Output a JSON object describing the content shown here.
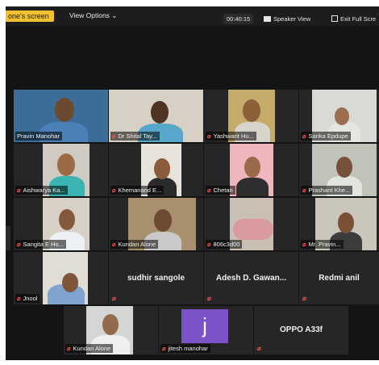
{
  "topbar": {
    "share_label": "one's screen",
    "view_options": "View Options ⌄",
    "clock": "00:40:15",
    "speaker_view": "Speaker View",
    "exit_fullscreen": "Exit Full Scre"
  },
  "participants": [
    {
      "name": "Pravin Manohar"
    },
    {
      "name": "Dr Shital Tay..."
    },
    {
      "name": "Yashwant Hu..."
    },
    {
      "name": "Sarika Epdupe"
    },
    {
      "name": "Aishwarya Ka..."
    },
    {
      "name": "Khemanand E..."
    },
    {
      "name": "Chetan"
    },
    {
      "name": "Prashant Khe..."
    },
    {
      "name": "Sangita E Ho..."
    },
    {
      "name": "Kundan Alone"
    },
    {
      "name": "806c3d00"
    },
    {
      "name": "Mr. Pravin..."
    },
    {
      "name": "Jnool"
    },
    {
      "name": "sudhir sangole"
    },
    {
      "name": "Adesh D. Gawan..."
    },
    {
      "name": "Redmi anil"
    },
    {
      "name": "Kundan Alone"
    },
    {
      "name": "jitesh manohar",
      "initial": "j"
    },
    {
      "name": "OPPO A33f"
    }
  ],
  "mute_icon": "mic-muted-icon",
  "colors": {
    "active_border": "#8fd14f",
    "mute": "#ff4a4a",
    "avatar": "#7b52c7"
  }
}
